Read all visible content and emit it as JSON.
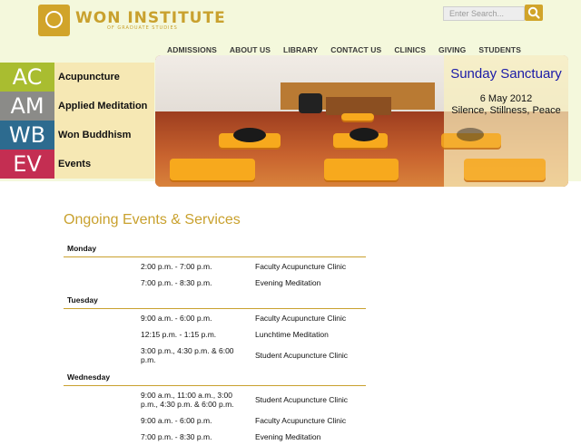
{
  "logo": {
    "title": "WON INSTITUTE",
    "subtitle": "OF GRADUATE STUDIES"
  },
  "search": {
    "placeholder": "Enter Search..."
  },
  "nav": [
    "ADMISSIONS",
    "ABOUT US",
    "LIBRARY",
    "CONTACT US",
    "CLINICS",
    "GIVING",
    "STUDENTS"
  ],
  "side": [
    {
      "abbr": "AC",
      "label": "Acupuncture",
      "color": "#a9bd30"
    },
    {
      "abbr": "AM",
      "label": "Applied Meditation",
      "color": "#8b8b88"
    },
    {
      "abbr": "WB",
      "label": "Won Buddhism",
      "color": "#2d6b8f"
    },
    {
      "abbr": "EV",
      "label": "Events",
      "color": "#c42e52"
    }
  ],
  "hero": {
    "title": "Sunday Sanctuary",
    "date": "6 May 2012",
    "caption": "Silence, Stillness, Peace"
  },
  "section_title": "Ongoing Events & Services",
  "schedule": [
    {
      "day": "Monday",
      "items": [
        {
          "time": "2:00 p.m. - 7:00 p.m.",
          "event": "Faculty Acupuncture Clinic"
        },
        {
          "time": "7:00 p.m. - 8:30 p.m.",
          "event": "Evening Meditation"
        }
      ]
    },
    {
      "day": "Tuesday",
      "items": [
        {
          "time": "9:00 a.m. - 6:00 p.m.",
          "event": "Faculty Acupuncture Clinic"
        },
        {
          "time": "12:15 p.m. - 1:15 p.m.",
          "event": "Lunchtime Meditation"
        },
        {
          "time": "3:00 p.m., 4:30 p.m. & 6:00 p.m.",
          "event": "Student Acupuncture Clinic"
        }
      ]
    },
    {
      "day": "Wednesday",
      "items": [
        {
          "time": "9:00 a.m., 11:00 a.m., 3:00 p.m., 4:30 p.m. & 6:00 p.m.",
          "event": "Student Acupuncture Clinic"
        },
        {
          "time": "9:00 a.m. - 6:00 p.m.",
          "event": "Faculty Acupuncture Clinic"
        },
        {
          "time": "7:00 p.m. - 8:30 p.m.",
          "event": "Evening Meditation"
        }
      ]
    }
  ]
}
